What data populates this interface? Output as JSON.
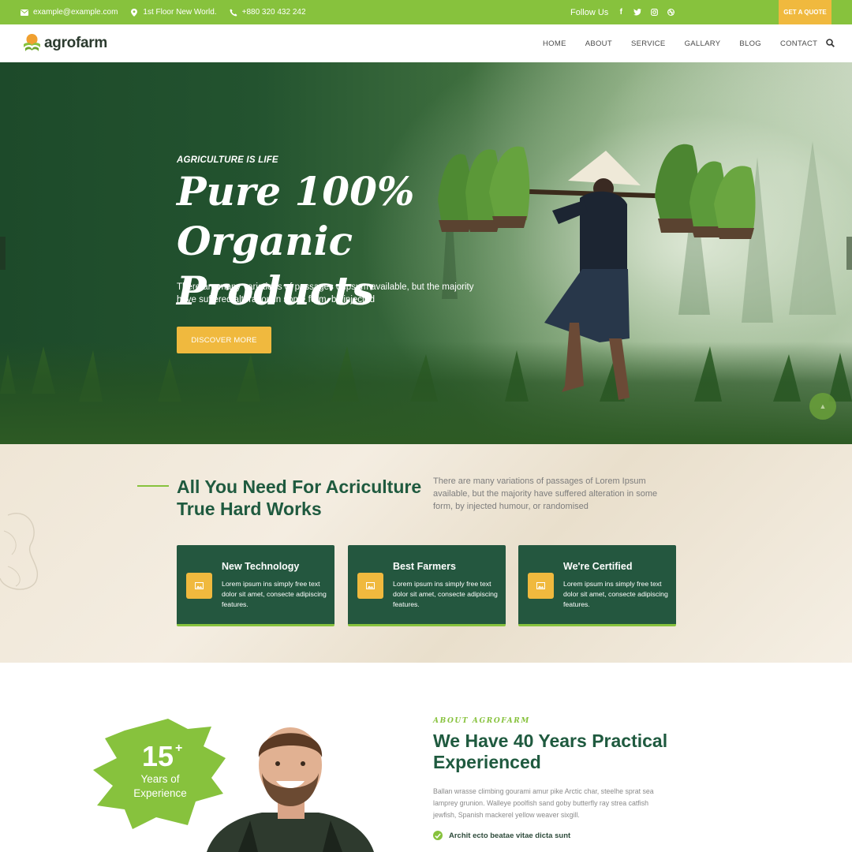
{
  "topbar": {
    "email": "example@example.com",
    "address": "1st Floor New World.",
    "phone": "+880 320 432 242",
    "follow_label": "Follow Us",
    "social": [
      "facebook-icon",
      "twitter-icon",
      "instagram-icon",
      "dribbble-icon"
    ],
    "quote_label": "GET A QUOTE"
  },
  "nav": {
    "brand": "agrofarm",
    "items": [
      "HOME",
      "ABOUT",
      "SERVICE",
      "GALLARY",
      "BLOG",
      "CONTACT"
    ]
  },
  "hero": {
    "eyebrow": "AGRICULTURE IS LIFE",
    "title_line1": "Pure 100%",
    "title_line2": "Organic Products",
    "description": "There are many variations of passages ofIpsum available, but the majority have suffered alteration in some form, by injected",
    "button_label": "DISCOVER MORE"
  },
  "features": {
    "title_line1": "All You Need For Acriculture",
    "title_line2": "True Hard Works",
    "description": "There are many variations of passages of Lorem Ipsum available, but the majority have suffered alteration in some form, by injected humour, or randomised",
    "cards": [
      {
        "title": "New Technology",
        "text": "Lorem ipsum ins simply free text dolor sit amet, consecte adipiscing features.",
        "icon": "image-icon"
      },
      {
        "title": "Best Farmers",
        "text": "Lorem ipsum ins simply free text dolor sit amet, consecte adipiscing features.",
        "icon": "image-icon"
      },
      {
        "title": "We're Certified",
        "text": "Lorem ipsum ins simply free text dolor sit amet, consecte adipiscing features.",
        "icon": "image-icon"
      }
    ]
  },
  "about": {
    "experience_number": "15",
    "experience_plus": "+",
    "experience_label": "Years of Experience",
    "eyebrow": "ABOUT AGROFARM",
    "title": "We Have 40 Years Practical Experienced",
    "description": "Ballan wrasse climbing gourami amur pike Arctic char, steelhe sprat sea lamprey grunion. Walleye poolfish sand goby butterfly ray strea catfish jewfish, Spanish mackerel yellow weaver sixgill.",
    "check_item": "Archit ecto beatae vitae dicta sunt"
  },
  "colors": {
    "brand_green": "#87c23d",
    "dark_green": "#24573f",
    "accent_yellow": "#f0b93e",
    "heading_green": "#1f5a3f"
  }
}
